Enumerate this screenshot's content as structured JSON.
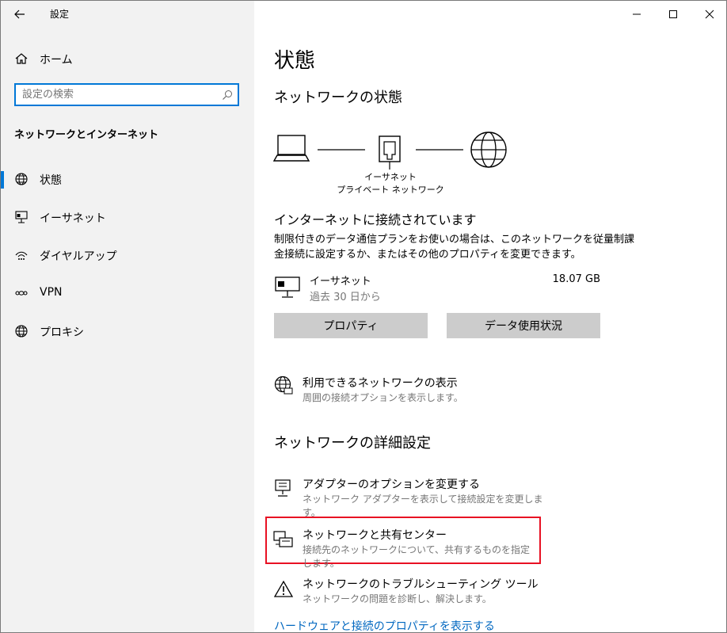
{
  "window": {
    "title": "設定",
    "back_label": "←",
    "minimize_label": "—",
    "maximize_label": "☐",
    "close_label": "✕"
  },
  "sidebar": {
    "home_label": "ホーム",
    "search_placeholder": "設定の検索",
    "section_title": "ネットワークとインターネット",
    "items": [
      {
        "label": "状態",
        "icon": "globe-icon",
        "selected": true
      },
      {
        "label": "イーサネット",
        "icon": "ethernet-icon",
        "selected": false
      },
      {
        "label": "ダイヤルアップ",
        "icon": "dialup-icon",
        "selected": false
      },
      {
        "label": "VPN",
        "icon": "vpn-icon",
        "selected": false
      },
      {
        "label": "プロキシ",
        "icon": "globe-icon",
        "selected": false
      }
    ]
  },
  "main": {
    "page_title": "状態",
    "network_status_heading": "ネットワークの状態",
    "diagram": {
      "line1": "イーサネット",
      "line2": "プライベート ネットワーク"
    },
    "connected_heading": "インターネットに接続されています",
    "connected_desc_line1": "制限付きのデータ通信プランをお使いの場合は、このネットワークを従量制課",
    "connected_desc_line2": "金接続に設定するか、またはその他のプロパティを変更できます。",
    "adapter": {
      "name": "イーサネット",
      "period": "過去 30 日から",
      "usage": "18.07 GB"
    },
    "properties_button": "プロパティ",
    "data_usage_button": "データ使用状況",
    "available_networks": {
      "title": "利用できるネットワークの表示",
      "subtitle": "周囲の接続オプションを表示します。"
    },
    "advanced_heading": "ネットワークの詳細設定",
    "adapter_options": {
      "title": "アダプターのオプションを変更する",
      "subtitle": "ネットワーク アダプターを表示して接続設定を変更します。"
    },
    "sharing_center": {
      "title": "ネットワークと共有センター",
      "subtitle": "接続先のネットワークについて、共有するものを指定します。"
    },
    "troubleshooter": {
      "title": "ネットワークのトラブルシューティング ツール",
      "subtitle": "ネットワークの問題を診断し、解決します。"
    },
    "hardware_link": "ハードウェアと接続のプロパティを表示する"
  },
  "colors": {
    "accent": "#0078d7",
    "link": "#0067c0",
    "highlight_border": "#e81123",
    "sidebar_bg": "#f2f2f2",
    "button_bg": "#cccccc"
  }
}
